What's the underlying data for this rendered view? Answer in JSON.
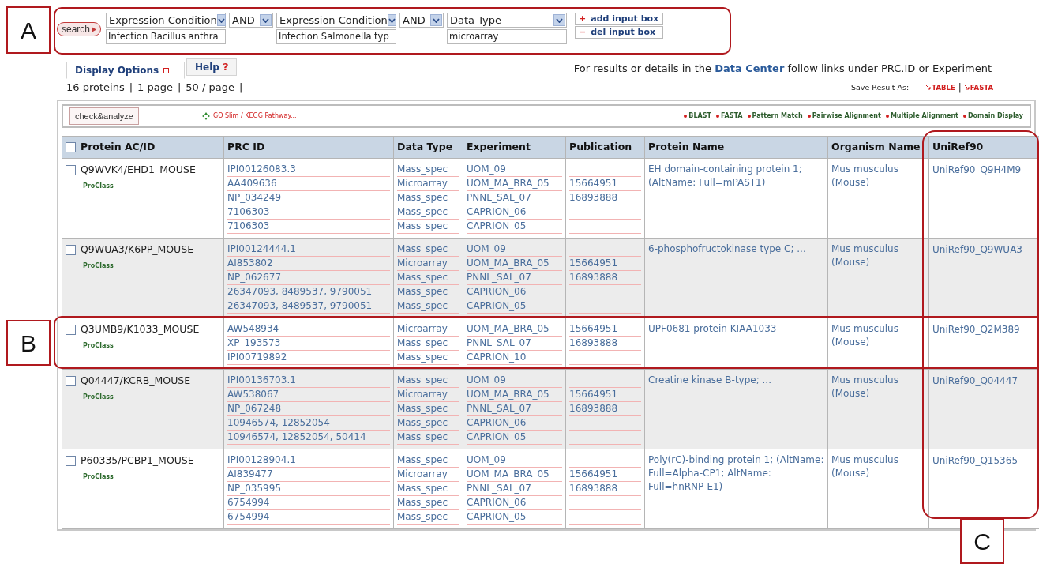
{
  "search_bar": {
    "search_button": "search",
    "criteria": [
      {
        "kind": "criterion",
        "field": "Expression Condition",
        "value": "Infection Bacillus anthra"
      },
      {
        "kind": "operator",
        "field": "AND"
      },
      {
        "kind": "criterion",
        "field": "Expression Condition",
        "value": "Infection Salmonella typ"
      },
      {
        "kind": "operator",
        "field": "AND"
      },
      {
        "kind": "criterion",
        "field": "Data Type",
        "value": "microarray"
      }
    ],
    "box_buttons": [
      {
        "symbol": "+",
        "label": "add input box"
      },
      {
        "symbol": "−",
        "label": "del input box"
      }
    ]
  },
  "tabs": [
    {
      "label": "Display Options",
      "selected": true
    },
    {
      "label": "Help",
      "mark": "?",
      "selected": false
    }
  ],
  "info": {
    "before": "For results or details in the ",
    "link": "Data Center",
    "after": " follow links under PRC.ID or Experiment"
  },
  "paging": {
    "items": [
      "16 proteins",
      "1 page",
      "50 / page"
    ],
    "separator": "|"
  },
  "save": {
    "label": "Save Result As:",
    "options": [
      "TABLE",
      "FASTA"
    ],
    "separator": "|"
  },
  "toolbar": {
    "check_button": "check&analyze",
    "pathway_link": "GO Slim / KEGG Pathway...",
    "tools": [
      "BLAST",
      "FASTA",
      "Pattern Match",
      "Pairwise Alignment",
      "Multiple Alignment",
      "Domain Display"
    ]
  },
  "table": {
    "header_checked": false,
    "columns": [
      "Protein AC/ID",
      "PRC ID",
      "Data Type",
      "Experiment",
      "Publication",
      "Protein Name",
      "Organism Name",
      "UniRef90"
    ],
    "rows": [
      {
        "checked": false,
        "protein": "Q9WVK4/EHD1_MOUSE",
        "sub_link": "ProClass",
        "protein_name": "EH domain-containing protein 1; (AltName: Full=mPAST1)",
        "organism": "Mus musculus (Mouse)",
        "uniref": "UniRef90_Q9H4M9",
        "entries": [
          {
            "prc_id": "IPI00126083.3",
            "data_type": "Mass_spec",
            "experiment": "UOM_09"
          },
          {
            "prc_id": "AA409636",
            "data_type": "Microarray",
            "experiment": "UOM_MA_BRA_05",
            "publication": "15664951"
          },
          {
            "prc_id": "NP_034249",
            "data_type": "Mass_spec",
            "experiment": "PNNL_SAL_07",
            "publication": "16893888"
          },
          {
            "prc_id": "7106303",
            "data_type": "Mass_spec",
            "experiment": "CAPRION_06"
          },
          {
            "prc_id": "7106303",
            "data_type": "Mass_spec",
            "experiment": "CAPRION_05"
          }
        ]
      },
      {
        "checked": false,
        "protein": "Q9WUA3/K6PP_MOUSE",
        "sub_link": "ProClass",
        "protein_name": "6-phosphofructokinase type C; ...",
        "organism": "Mus musculus (Mouse)",
        "uniref": "UniRef90_Q9WUA3",
        "entries": [
          {
            "prc_id": "IPI00124444.1",
            "data_type": "Mass_spec",
            "experiment": "UOM_09"
          },
          {
            "prc_id": "AI853802",
            "data_type": "Microarray",
            "experiment": "UOM_MA_BRA_05",
            "publication": "15664951"
          },
          {
            "prc_id": "NP_062677",
            "data_type": "Mass_spec",
            "experiment": "PNNL_SAL_07",
            "publication": "16893888"
          },
          {
            "prc_id": "26347093, 8489537, 9790051",
            "data_type": "Mass_spec",
            "experiment": "CAPRION_06"
          },
          {
            "prc_id": "26347093, 8489537, 9790051",
            "data_type": "Mass_spec",
            "experiment": "CAPRION_05"
          }
        ]
      },
      {
        "checked": false,
        "protein": "Q3UMB9/K1033_MOUSE",
        "sub_link": "ProClass",
        "protein_name": "UPF0681 protein KIAA1033",
        "organism": "Mus musculus (Mouse)",
        "uniref": "UniRef90_Q2M389",
        "entries": [
          {
            "prc_id": "AW548934",
            "data_type": "Microarray",
            "experiment": "UOM_MA_BRA_05",
            "publication": "15664951"
          },
          {
            "prc_id": "XP_193573",
            "data_type": "Mass_spec",
            "experiment": "PNNL_SAL_07",
            "publication": "16893888"
          },
          {
            "prc_id": "IPI00719892",
            "data_type": "Mass_spec",
            "experiment": "CAPRION_10"
          }
        ]
      },
      {
        "checked": false,
        "protein": "Q04447/KCRB_MOUSE",
        "sub_link": "ProClass",
        "protein_name": "Creatine kinase B-type; ...",
        "organism": "Mus musculus (Mouse)",
        "uniref": "UniRef90_Q04447",
        "entries": [
          {
            "prc_id": "IPI00136703.1",
            "data_type": "Mass_spec",
            "experiment": "UOM_09"
          },
          {
            "prc_id": "AW538067",
            "data_type": "Microarray",
            "experiment": "UOM_MA_BRA_05",
            "publication": "15664951"
          },
          {
            "prc_id": "NP_067248",
            "data_type": "Mass_spec",
            "experiment": "PNNL_SAL_07",
            "publication": "16893888"
          },
          {
            "prc_id": "10946574, 12852054",
            "data_type": "Mass_spec",
            "experiment": "CAPRION_06"
          },
          {
            "prc_id": "10946574, 12852054, 50414",
            "data_type": "Mass_spec",
            "experiment": "CAPRION_05"
          }
        ]
      },
      {
        "checked": false,
        "protein": "P60335/PCBP1_MOUSE",
        "sub_link": "ProClass",
        "protein_name": "Poly(rC)-binding protein 1; (AltName: Full=Alpha-CP1; AltName: Full=hnRNP-E1)",
        "organism": "Mus musculus (Mouse)",
        "uniref": "UniRef90_Q15365",
        "entries": [
          {
            "prc_id": "IPI00128904.1",
            "data_type": "Mass_spec",
            "experiment": "UOM_09"
          },
          {
            "prc_id": "AI839477",
            "data_type": "Microarray",
            "experiment": "UOM_MA_BRA_05",
            "publication": "15664951"
          },
          {
            "prc_id": "NP_035995",
            "data_type": "Mass_spec",
            "experiment": "PNNL_SAL_07",
            "publication": "16893888"
          },
          {
            "prc_id": "6754994",
            "data_type": "Mass_spec",
            "experiment": "CAPRION_06"
          },
          {
            "prc_id": "6754994",
            "data_type": "Mass_spec",
            "experiment": "CAPRION_05"
          }
        ]
      }
    ]
  },
  "callouts": [
    {
      "label": "A"
    },
    {
      "label": "B"
    },
    {
      "label": "C"
    }
  ]
}
